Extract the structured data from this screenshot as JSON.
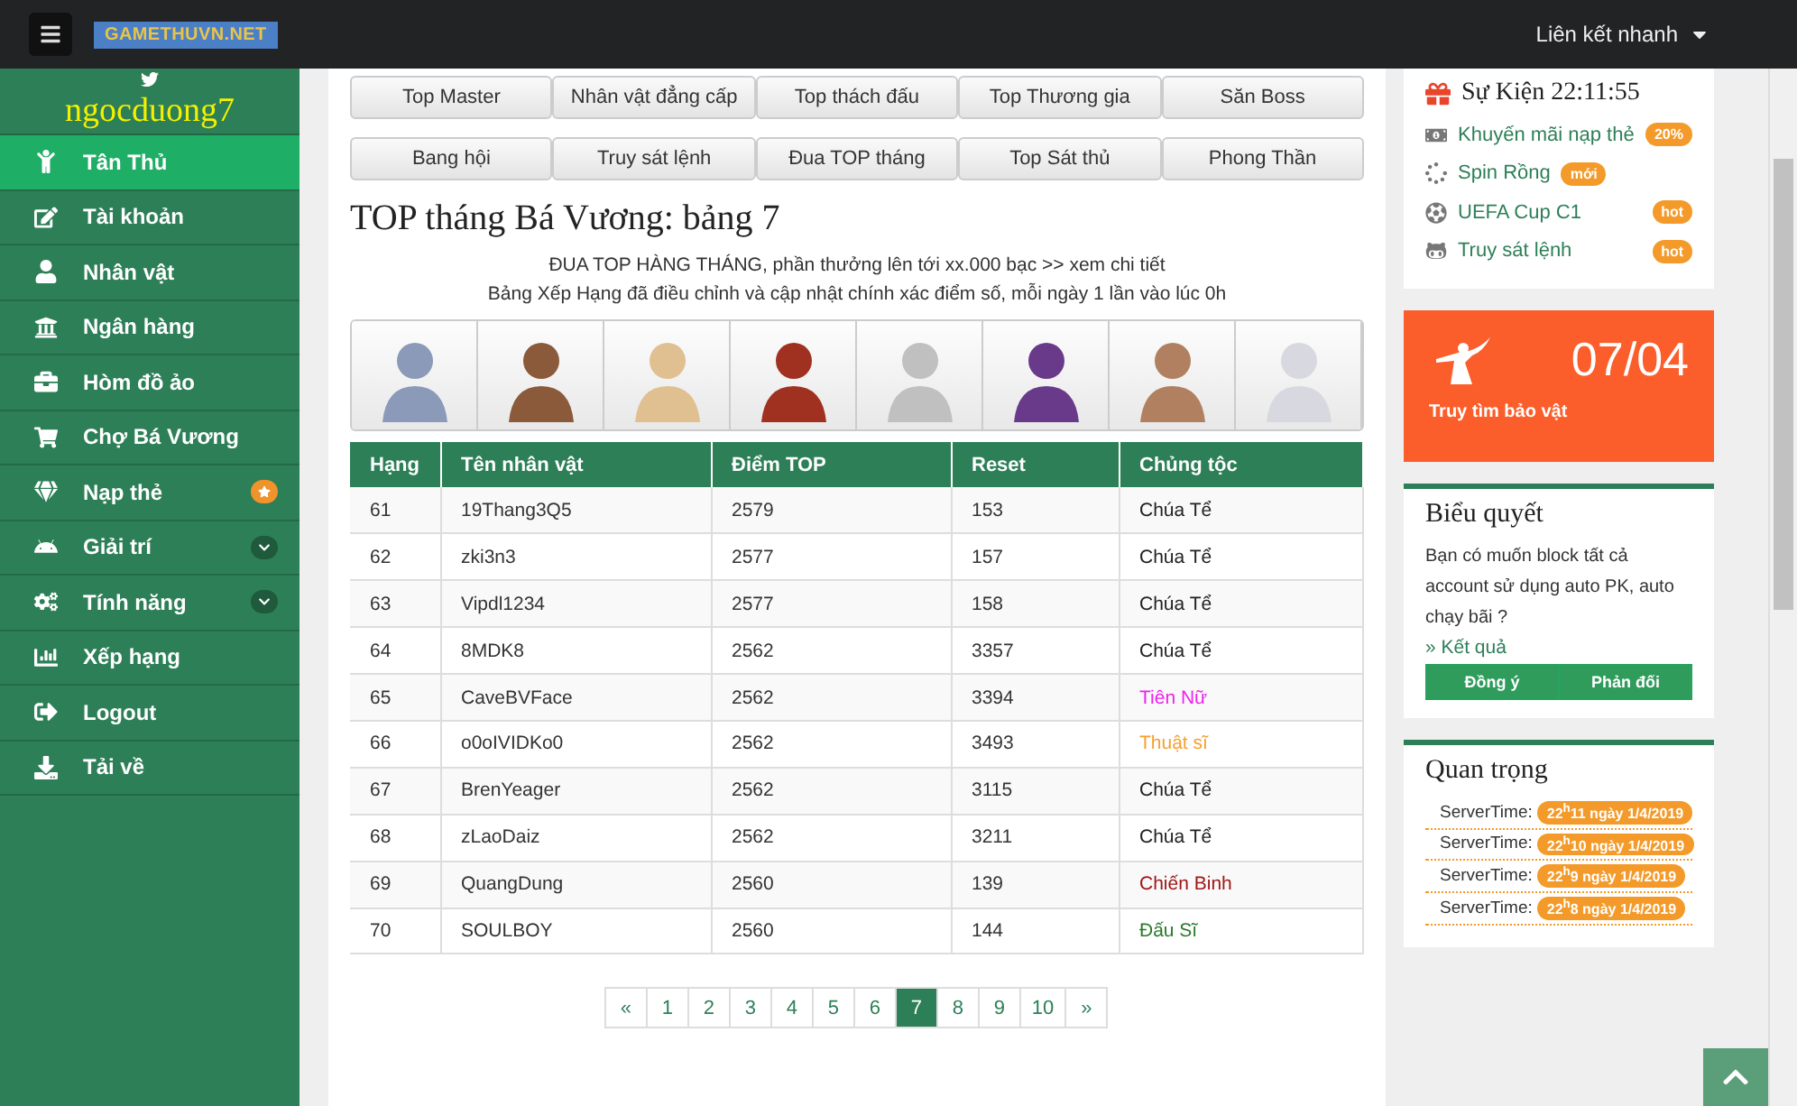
{
  "header": {
    "logo": "GAMETHUVN.NET",
    "quick_links": "Liên kết nhanh"
  },
  "sidebar": {
    "username": "ngocduong7",
    "items": [
      {
        "label": "Tân Thủ",
        "selected": true,
        "starred": false,
        "expandable": false
      },
      {
        "label": "Tài khoản",
        "selected": false,
        "starred": false,
        "expandable": false
      },
      {
        "label": "Nhân vật",
        "selected": false,
        "starred": false,
        "expandable": false
      },
      {
        "label": "Ngân hàng",
        "selected": false,
        "starred": false,
        "expandable": false
      },
      {
        "label": "Hòm đồ ảo",
        "selected": false,
        "starred": false,
        "expandable": false
      },
      {
        "label": "Chợ Bá Vương",
        "selected": false,
        "starred": false,
        "expandable": false
      },
      {
        "label": "Nạp thẻ",
        "selected": false,
        "starred": true,
        "expandable": false
      },
      {
        "label": "Giải trí",
        "selected": false,
        "starred": false,
        "expandable": true
      },
      {
        "label": "Tính năng",
        "selected": false,
        "starred": false,
        "expandable": true
      },
      {
        "label": "Xếp hạng",
        "selected": false,
        "starred": false,
        "expandable": false
      },
      {
        "label": "Logout",
        "selected": false,
        "starred": false,
        "expandable": false
      },
      {
        "label": "Tải về",
        "selected": false,
        "starred": false,
        "expandable": false
      }
    ]
  },
  "main": {
    "tab_rows": [
      [
        "Top Master",
        "Nhân vật đẳng cấp",
        "Top thách đấu",
        "Top Thương gia",
        "Săn Boss"
      ],
      [
        "Bang hội",
        "Truy sát lệnh",
        "Đua TOP tháng",
        "Top Sát thủ",
        "Phong Thần"
      ]
    ],
    "title": "TOP tháng Bá Vương: bảng 7",
    "notices": [
      "ĐUA TOP HÀNG THÁNG, phần thưởng lên tới xx.000 bạc >> xem chi tiết",
      "Bảng Xếp Hạng đã điều chỉnh và cập nhật chính xác điểm số, mỗi ngày 1 lần vào lúc 0h"
    ],
    "table": {
      "columns": [
        "Hạng",
        "Tên nhân vật",
        "Điểm TOP",
        "Reset",
        "Chủng tộc"
      ],
      "rows": [
        {
          "cells": [
            "61",
            "19Thang3Q5",
            "2579",
            "153",
            "Chúa Tể"
          ],
          "color": "#222222"
        },
        {
          "cells": [
            "62",
            "zki3n3",
            "2577",
            "157",
            "Chúa Tể"
          ],
          "color": "#222222"
        },
        {
          "cells": [
            "63",
            "Vipdl1234",
            "2577",
            "158",
            "Chúa Tể"
          ],
          "color": "#222222"
        },
        {
          "cells": [
            "64",
            "8MDK8",
            "2562",
            "3357",
            "Chúa Tể"
          ],
          "color": "#222222"
        },
        {
          "cells": [
            "65",
            "CaveBVFace",
            "2562",
            "3394",
            "Tiên Nữ"
          ],
          "color": "#ee22ee"
        },
        {
          "cells": [
            "66",
            "o0oIVIDKo0",
            "2562",
            "3493",
            "Thuật sĩ"
          ],
          "color": "#f5a030"
        },
        {
          "cells": [
            "67",
            "BrenYeager",
            "2562",
            "3115",
            "Chúa Tể"
          ],
          "color": "#222222"
        },
        {
          "cells": [
            "68",
            "zLaoDaiz",
            "2562",
            "3211",
            "Chúa Tể"
          ],
          "color": "#222222"
        },
        {
          "cells": [
            "69",
            "QuangDung",
            "2560",
            "139",
            "Chiến Binh"
          ],
          "color": "#a01818"
        },
        {
          "cells": [
            "70",
            "SOULBOY",
            "2560",
            "144",
            "Đấu Sĩ"
          ],
          "color": "#2a7a2a"
        }
      ]
    },
    "pagination": {
      "prev": "«",
      "next": "»",
      "pages": [
        {
          "label": "1",
          "selected": false
        },
        {
          "label": "2",
          "selected": false
        },
        {
          "label": "3",
          "selected": false
        },
        {
          "label": "4",
          "selected": false
        },
        {
          "label": "5",
          "selected": false
        },
        {
          "label": "6",
          "selected": false
        },
        {
          "label": "7",
          "selected": true
        },
        {
          "label": "8",
          "selected": false
        },
        {
          "label": "9",
          "selected": false
        },
        {
          "label": "10",
          "selected": false
        }
      ]
    }
  },
  "right": {
    "events": {
      "title": "Sự Kiện 22:11:55",
      "items": [
        {
          "label": "Khuyến mãi nạp thẻ",
          "badge": "20%",
          "badge_inline": false
        },
        {
          "label": "Spin Rồng",
          "badge": "mới",
          "badge_inline": true
        },
        {
          "label": "UEFA Cup C1",
          "badge": "hot",
          "badge_inline": false
        },
        {
          "label": "Truy sát lệnh",
          "badge": "hot",
          "badge_inline": false
        }
      ]
    },
    "promo": {
      "date": "07/04",
      "label": "Truy tìm bảo vật"
    },
    "vote": {
      "title": "Biểu quyết",
      "question": "Bạn có muốn block tất cả account sử dụng auto PK, auto chạy bãi ?",
      "result_link": "» Kết quả",
      "buttons": [
        "Đồng ý",
        "Phản đối"
      ]
    },
    "important": {
      "title": "Quan trọng",
      "items": [
        {
          "label": "ServerTime:",
          "time": "22$^{h}$11 ngày 1/4/2019"
        },
        {
          "label": "ServerTime:",
          "time": "22$^{h}$10 ngày 1/4/2019"
        },
        {
          "label": "ServerTime:",
          "time": "22$^{h}$9 ngày 1/4/2019"
        },
        {
          "label": "ServerTime:",
          "time": "22$^{h}$8 ngày 1/4/2019"
        }
      ]
    }
  }
}
